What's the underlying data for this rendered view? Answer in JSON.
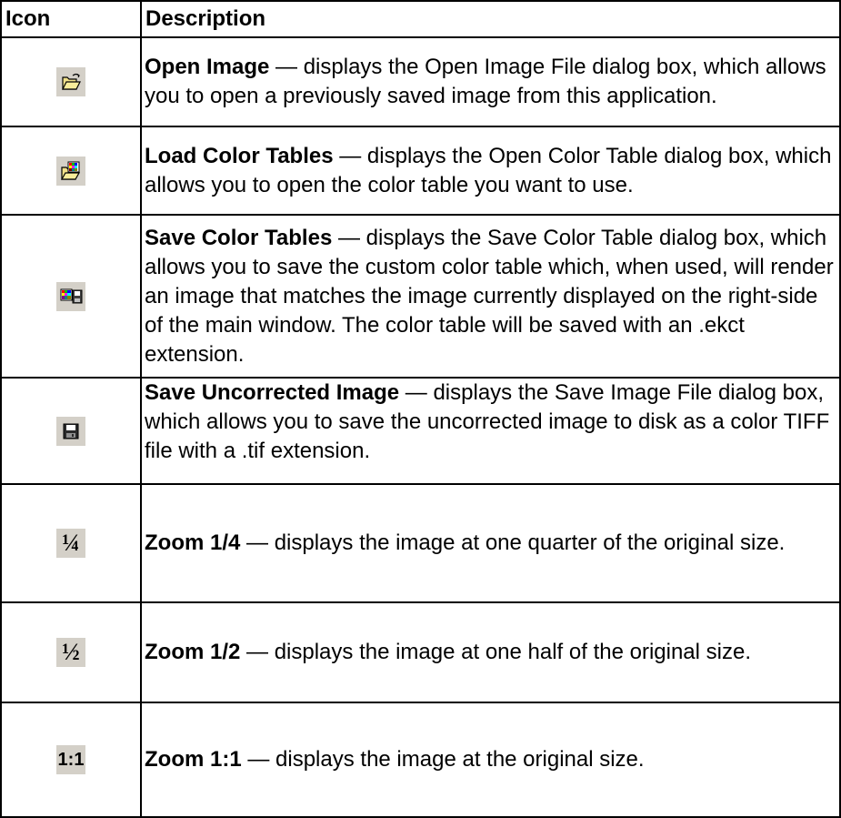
{
  "header": {
    "icon_label": "Icon",
    "description_label": "Description"
  },
  "rows": [
    {
      "icon": "open-folder-icon",
      "term": "Open Image",
      "text": " — displays the Open Image File dialog box, which allows you to open a previously saved image from this application."
    },
    {
      "icon": "load-color-table-icon",
      "term": "Load Color Tables",
      "text": " — displays the Open Color Table dialog box, which allows you to open the color table you want to use."
    },
    {
      "icon": "save-color-table-icon",
      "term": "Save Color Tables",
      "text": " — displays the Save Color Table dialog box, which allows you to save the custom color table which, when used, will render an image that matches the image currently displayed on the right-side of the main window. The color table will be saved with an .ekct extension."
    },
    {
      "icon": "floppy-disk-icon",
      "term": "Save Uncorrected Image",
      "text": " — displays the Save Image File dialog box, which allows you to save the uncorrected image to disk as a color TIFF file with a .tif extension."
    },
    {
      "icon": "zoom-quarter-icon",
      "icon_text": "¼",
      "term": "Zoom 1/4",
      "text": " — displays the image at one quarter of the original size."
    },
    {
      "icon": "zoom-half-icon",
      "icon_text": "½",
      "term": "Zoom 1/2",
      "text": " — displays the image at one half of the original size."
    },
    {
      "icon": "zoom-full-icon",
      "icon_text": "1:1",
      "term": "Zoom 1:1",
      "text": " — displays the image at the original size."
    }
  ]
}
